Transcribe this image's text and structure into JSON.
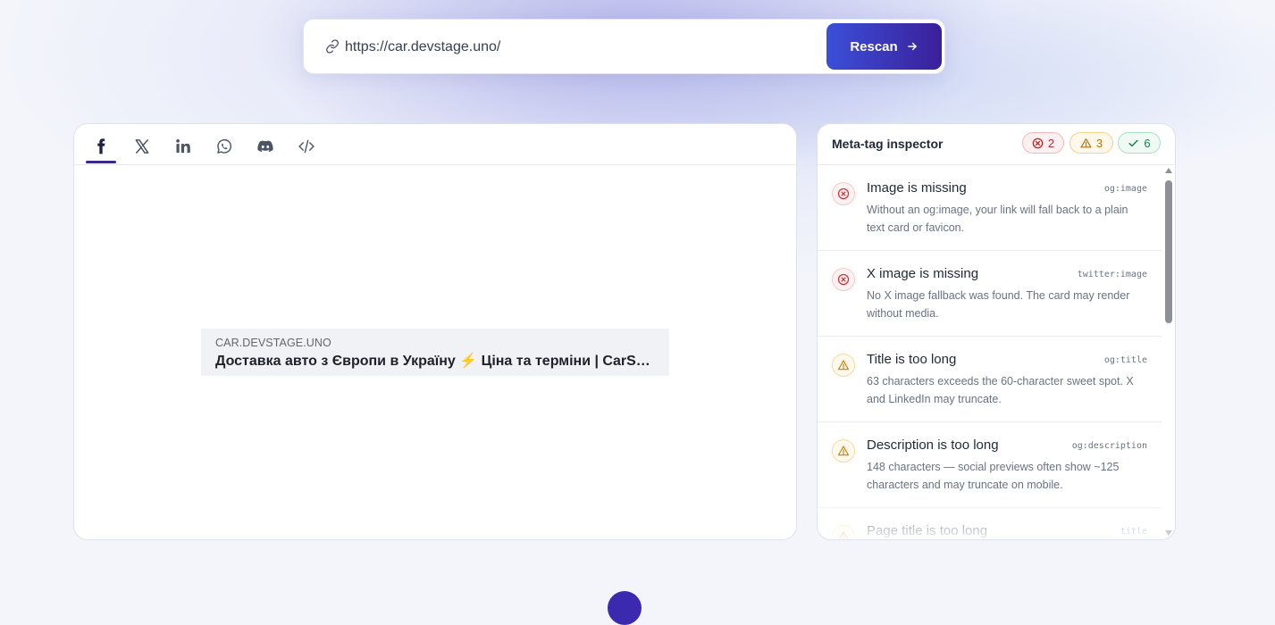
{
  "url_bar": {
    "url": "https://car.devstage.uno/",
    "rescan_label": "Rescan"
  },
  "preview": {
    "tabs": [
      {
        "id": "facebook",
        "icon": "facebook-icon",
        "active": true
      },
      {
        "id": "x",
        "icon": "x-icon",
        "active": false
      },
      {
        "id": "linkedin",
        "icon": "linkedin-icon",
        "active": false
      },
      {
        "id": "whatsapp",
        "icon": "whatsapp-icon",
        "active": false
      },
      {
        "id": "discord",
        "icon": "discord-icon",
        "active": false
      },
      {
        "id": "code",
        "icon": "code-icon",
        "active": false
      }
    ],
    "card": {
      "domain": "CAR.DEVSTAGE.UNO",
      "title": "Доставка авто з Європи в Україну ⚡ Ціна та терміни | CarStage"
    }
  },
  "inspector": {
    "title": "Meta-tag inspector",
    "counts": {
      "errors": "2",
      "warnings": "3",
      "ok": "6"
    },
    "issues": [
      {
        "severity": "error",
        "title": "Image is missing",
        "tag": "og:image",
        "description": "Without an og:image, your link will fall back to a plain text card or favicon."
      },
      {
        "severity": "error",
        "title": "X image is missing",
        "tag": "twitter:image",
        "description": "No X image fallback was found. The card may render without media."
      },
      {
        "severity": "warning",
        "title": "Title is too long",
        "tag": "og:title",
        "description": "63 characters exceeds the 60-character sweet spot. X and LinkedIn may truncate."
      },
      {
        "severity": "warning",
        "title": "Description is too long",
        "tag": "og:description",
        "description": "148 characters — social previews often show ~125 characters and may truncate on mobile."
      },
      {
        "severity": "warning",
        "title": "Page title is too long",
        "tag": "title",
        "description": ""
      }
    ]
  },
  "colors": {
    "accent": "#3b2a8c",
    "button_start": "#3b4fd8",
    "button_end": "#3b1f9a",
    "error": "#c0262d",
    "warning": "#b3700b",
    "ok": "#157f4a"
  }
}
